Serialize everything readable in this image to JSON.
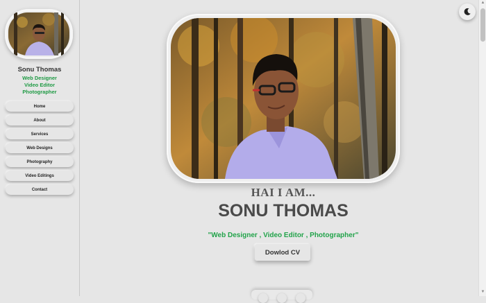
{
  "sidebar": {
    "profile_name": "Sonu Thomas",
    "roles": [
      "Web Designer",
      "Video Editor",
      "Photographer"
    ],
    "nav": [
      {
        "label": "Home"
      },
      {
        "label": "About"
      },
      {
        "label": "Services"
      },
      {
        "label": "Web Designs"
      },
      {
        "label": "Photography"
      },
      {
        "label": "Video Editings"
      },
      {
        "label": "Contact"
      }
    ]
  },
  "hero": {
    "greeting": "HAI I AM...",
    "name": "SONU THOMAS",
    "tagline": "\"Web Designer , Video Editor , Photographer\"",
    "cv_button": "Dowlod CV"
  },
  "icons": {
    "theme_toggle": "moon-icon"
  },
  "colors": {
    "accent_green": "#22a34a",
    "background": "#e6e6e6"
  }
}
